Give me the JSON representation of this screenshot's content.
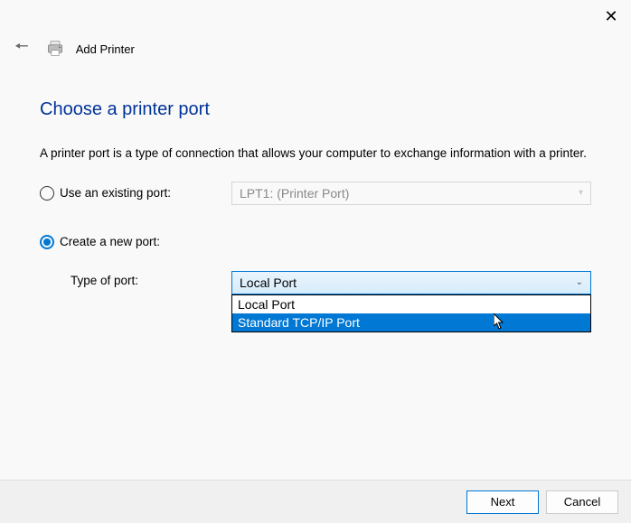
{
  "header": {
    "title": "Add Printer"
  },
  "page": {
    "heading": "Choose a printer port",
    "description": "A printer port is a type of connection that allows your computer to exchange information with a printer."
  },
  "options": {
    "use_existing": {
      "label": "Use an existing port:",
      "value": "LPT1: (Printer Port)"
    },
    "create_new": {
      "label": "Create a new port:",
      "sublabel": "Type of port:"
    }
  },
  "port_type": {
    "selected": "Local Port",
    "items": [
      "Local Port",
      "Standard TCP/IP Port"
    ],
    "highlighted_index": 1
  },
  "buttons": {
    "next": "Next",
    "cancel": "Cancel"
  }
}
